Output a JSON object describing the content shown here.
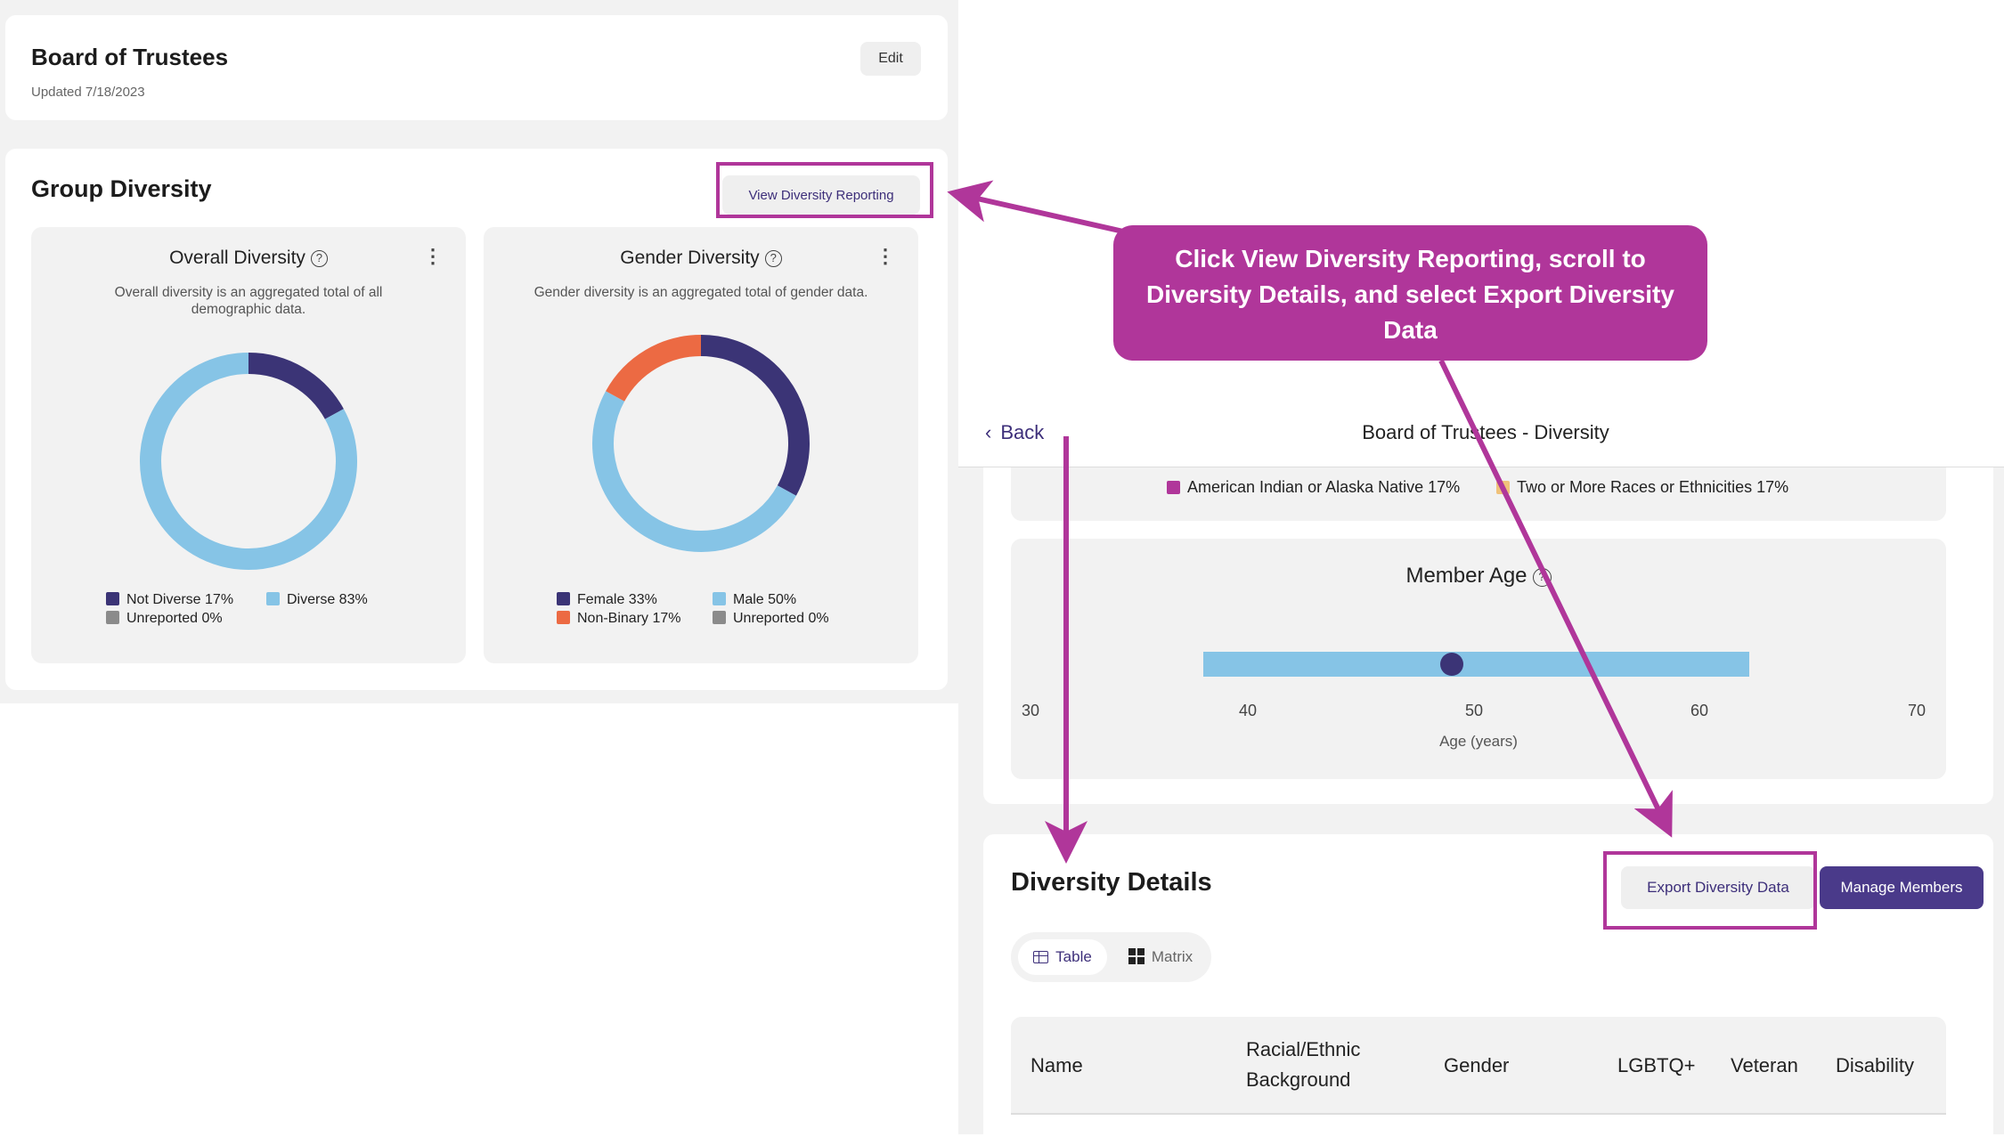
{
  "left": {
    "board_title": "Board of Trustees",
    "updated": "Updated 7/18/2023",
    "edit_label": "Edit",
    "group_title": "Group Diversity",
    "view_report_label": "View Diversity Reporting",
    "help_glyph": "?",
    "kebab_glyph": "⋮",
    "overall": {
      "title": "Overall Diversity",
      "desc": "Overall diversity is an aggregated total of all demographic data.",
      "legend": [
        "Not Diverse 17%",
        "Diverse 83%",
        "Unreported 0%"
      ]
    },
    "gender": {
      "title": "Gender Diversity",
      "desc": "Gender diversity is an aggregated total of gender data.",
      "legend": [
        "Female 33%",
        "Male 50%",
        "Non-Binary 17%",
        "Unreported 0%"
      ]
    }
  },
  "right": {
    "back_label": "Back",
    "back_glyph": "‹",
    "title": "Board of Trustees - Diversity",
    "race_legend": [
      "American Indian or Alaska Native 17%",
      "Two or More Races or Ethnicities 17%"
    ],
    "age_title": "Member Age",
    "age_ticks": [
      "30",
      "40",
      "50",
      "60",
      "70"
    ],
    "age_xlabel": "Age (years)",
    "details_title": "Diversity Details",
    "export_label": "Export Diversity Data",
    "manage_label": "Manage Members",
    "tab_table": "Table",
    "tab_matrix": "Matrix",
    "columns": [
      "Name",
      "Racial/Ethnic Background",
      "Gender",
      "LGBTQ+",
      "Veteran",
      "Disability"
    ]
  },
  "callout_text": "Click View Diversity Reporting, scroll to Diversity Details, and select Export Diversity Data",
  "colors": {
    "navy": "#3b3476",
    "light_blue": "#86c4e6",
    "orange": "#ec6a43",
    "gray": "#8b8b8b",
    "magenta": "#b0369a",
    "race_indian": "#b0369a",
    "race_two": "#f0c27a"
  },
  "chart_data": [
    {
      "type": "pie",
      "title": "Overall Diversity",
      "categories": [
        "Not Diverse",
        "Diverse",
        "Unreported"
      ],
      "values": [
        17,
        83,
        0
      ]
    },
    {
      "type": "pie",
      "title": "Gender Diversity",
      "categories": [
        "Female",
        "Male",
        "Non-Binary",
        "Unreported"
      ],
      "values": [
        33,
        50,
        17,
        0
      ]
    },
    {
      "type": "bar",
      "title": "Member Age",
      "xlabel": "Age (years)",
      "xlim": [
        30,
        70
      ],
      "range": [
        38.9,
        62.1
      ],
      "marker": 48.5
    }
  ]
}
